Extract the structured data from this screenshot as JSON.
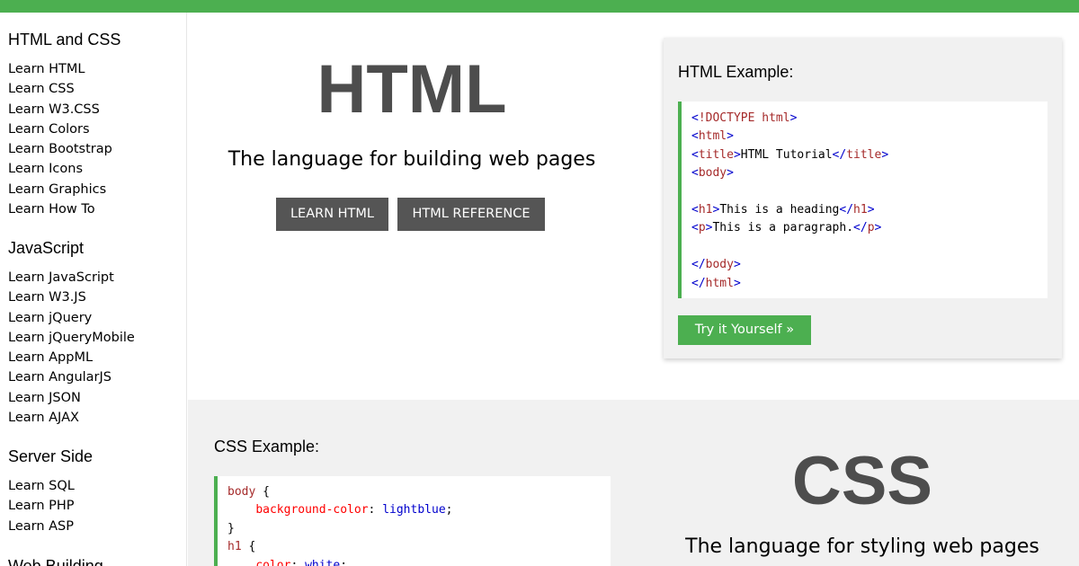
{
  "colors": {
    "accent": "#4caf50",
    "dark_button": "#555555",
    "panel": "#f1f1f1"
  },
  "sidebar": {
    "sections": [
      {
        "heading": "HTML and CSS",
        "links": [
          "Learn HTML",
          "Learn CSS",
          "Learn W3.CSS",
          "Learn Colors",
          "Learn Bootstrap",
          "Learn Icons",
          "Learn Graphics",
          "Learn How To"
        ]
      },
      {
        "heading": "JavaScript",
        "links": [
          "Learn JavaScript",
          "Learn W3.JS",
          "Learn jQuery",
          "Learn jQueryMobile",
          "Learn AppML",
          "Learn AngularJS",
          "Learn JSON",
          "Learn AJAX"
        ]
      },
      {
        "heading": "Server Side",
        "links": [
          "Learn SQL",
          "Learn PHP",
          "Learn ASP"
        ]
      },
      {
        "heading": "Web Building",
        "links": []
      }
    ]
  },
  "html_hero": {
    "title": "HTML",
    "subtitle": "The language for building web pages",
    "learn_button": "LEARN HTML",
    "reference_button": "HTML REFERENCE"
  },
  "html_example": {
    "title": "HTML Example:",
    "code_lines": [
      [
        [
          "br",
          "<"
        ],
        [
          "tag",
          "!DOCTYPE html"
        ],
        [
          "br",
          ">"
        ]
      ],
      [
        [
          "br",
          "<"
        ],
        [
          "tag",
          "html"
        ],
        [
          "br",
          ">"
        ]
      ],
      [
        [
          "br",
          "<"
        ],
        [
          "tag",
          "title"
        ],
        [
          "br",
          ">"
        ],
        [
          "txt",
          "HTML Tutorial"
        ],
        [
          "br",
          "</"
        ],
        [
          "tag",
          "title"
        ],
        [
          "br",
          ">"
        ]
      ],
      [
        [
          "br",
          "<"
        ],
        [
          "tag",
          "body"
        ],
        [
          "br",
          ">"
        ]
      ],
      [],
      [
        [
          "br",
          "<"
        ],
        [
          "tag",
          "h1"
        ],
        [
          "br",
          ">"
        ],
        [
          "txt",
          "This is a heading"
        ],
        [
          "br",
          "</"
        ],
        [
          "tag",
          "h1"
        ],
        [
          "br",
          ">"
        ]
      ],
      [
        [
          "br",
          "<"
        ],
        [
          "tag",
          "p"
        ],
        [
          "br",
          ">"
        ],
        [
          "txt",
          "This is a paragraph."
        ],
        [
          "br",
          "</"
        ],
        [
          "tag",
          "p"
        ],
        [
          "br",
          ">"
        ]
      ],
      [],
      [
        [
          "br",
          "</"
        ],
        [
          "tag",
          "body"
        ],
        [
          "br",
          ">"
        ]
      ],
      [
        [
          "br",
          "</"
        ],
        [
          "tag",
          "html"
        ],
        [
          "br",
          ">"
        ]
      ]
    ],
    "try_button": "Try it Yourself »"
  },
  "css_example": {
    "title": "CSS Example:",
    "code_lines": [
      [
        [
          "sel",
          "body"
        ],
        [
          "txt",
          " {"
        ]
      ],
      [
        [
          "txt",
          "    "
        ],
        [
          "prop",
          "background-color"
        ],
        [
          "txt",
          ": "
        ],
        [
          "val",
          "lightblue"
        ],
        [
          "txt",
          ";"
        ]
      ],
      [
        [
          "txt",
          "}"
        ]
      ],
      [
        [
          "sel",
          "h1"
        ],
        [
          "txt",
          " {"
        ]
      ],
      [
        [
          "txt",
          "    "
        ],
        [
          "prop",
          "color"
        ],
        [
          "txt",
          ": "
        ],
        [
          "val",
          "white"
        ],
        [
          "txt",
          ";"
        ]
      ]
    ]
  },
  "css_hero": {
    "title": "CSS",
    "subtitle": "The language for styling web pages"
  }
}
